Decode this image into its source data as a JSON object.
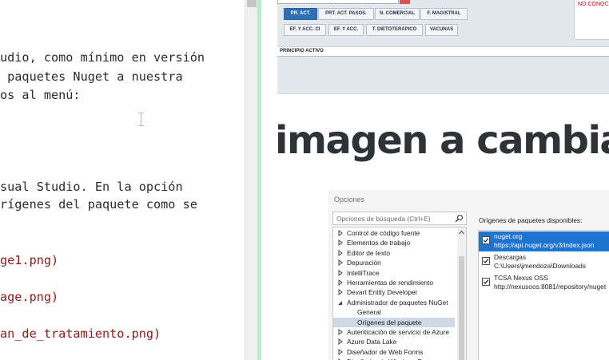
{
  "editor": {
    "lines": [
      {
        "text": "udio, como mínimo en versión",
        "kind": "text"
      },
      {
        "text": " paquetes Nuget a nuestra",
        "kind": "text"
      },
      {
        "text": "os al menú:",
        "kind": "text"
      },
      {
        "text": "sual Studio. En la opción",
        "kind": "text"
      },
      {
        "text": "rígenes del paquete como se",
        "kind": "text"
      },
      {
        "text": "ge1.png)",
        "kind": "link"
      },
      {
        "text": "age.png)",
        "kind": "link"
      },
      {
        "text": "an_de_tratamiento.png)",
        "kind": "link"
      }
    ]
  },
  "top_screenshot": {
    "tabs_row1": [
      "PR. ACT.",
      "PRT. ACT. PASOS.",
      "N. COMERCIAL",
      "F. MAGISTRAL"
    ],
    "tabs_row2": [
      "EF. Y ACC. CI",
      "EF. Y ACC.",
      "T. DIETOTERÁPICO",
      "VACUNAS"
    ],
    "active_tab": "PR. ACT.",
    "status_text": "NO CONOC",
    "column_header": "PRINCIPIO ACTIVO",
    "colors": {
      "active_tab": "#2f6fb6",
      "status": "#d0021b",
      "splitter": "#b7ecc9"
    }
  },
  "preview": {
    "heading": "imagen a cambiar"
  },
  "options_dialog": {
    "title": "Opciones",
    "search_placeholder": "Opciones de búsqueda (Ctrl+E)",
    "tree": [
      {
        "label": "Control de código fuente",
        "state": "collapsed",
        "level": 0
      },
      {
        "label": "Elementos de trabajo",
        "state": "collapsed",
        "level": 0
      },
      {
        "label": "Editor de texto",
        "state": "collapsed",
        "level": 0
      },
      {
        "label": "Depuración",
        "state": "collapsed",
        "level": 0
      },
      {
        "label": "IntelliTrace",
        "state": "collapsed",
        "level": 0
      },
      {
        "label": "Herramientas de rendimiento",
        "state": "collapsed",
        "level": 0
      },
      {
        "label": "Devart Entity Developer",
        "state": "collapsed",
        "level": 0
      },
      {
        "label": "Administrador de paquetes NuGet",
        "state": "expanded",
        "level": 0
      },
      {
        "label": "General",
        "state": "leaf",
        "level": 1
      },
      {
        "label": "Orígenes del paquete",
        "state": "leaf",
        "level": 1,
        "selected": true
      },
      {
        "label": "Autenticación de servicio de Azure",
        "state": "collapsed",
        "level": 0
      },
      {
        "label": "Azure Data Lake",
        "state": "collapsed",
        "level": 0
      },
      {
        "label": "Diseñador de Web Forms",
        "state": "collapsed",
        "level": 0
      },
      {
        "label": "Diseñador de Windows Forms",
        "state": "collapsed",
        "level": 0
      }
    ],
    "sources_header": "Orígenes de paquetes disponibles:",
    "sources": [
      {
        "name": "nuget.org",
        "url": "https://api.nuget.org/v3/index.json",
        "checked": true,
        "selected": true
      },
      {
        "name": "Descargas",
        "url": "C:\\Users\\jmendoza\\Downloads",
        "checked": true,
        "selected": false
      },
      {
        "name": "TCSA Nexus OSS",
        "url": "http://nexusoos:8081/repository/nuget",
        "checked": true,
        "selected": false
      }
    ]
  }
}
